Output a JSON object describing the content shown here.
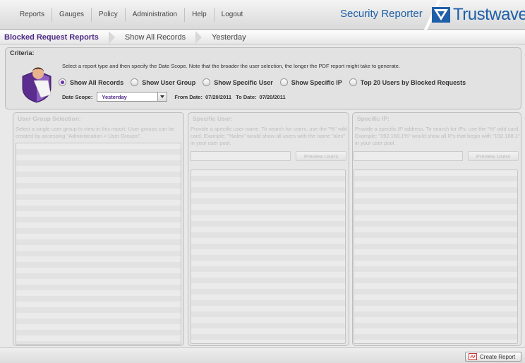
{
  "nav": {
    "items": [
      "Reports",
      "Gauges",
      "Policy",
      "Administration",
      "Help",
      "Logout"
    ]
  },
  "header": {
    "app_title": "Security Reporter",
    "brand_name": "Trustwave",
    "brand_mark": "®",
    "brand_color": "#1e5fa8"
  },
  "breadcrumb": {
    "items": [
      "Blocked Request Reports",
      "Show All Records",
      "Yesterday"
    ]
  },
  "criteria": {
    "title": "Criteria:",
    "instructions": "Select a report type and then specify the Date Scope. Note that the broader the user selection, the longer the PDF report might take to generate.",
    "report_types": [
      {
        "label": "Show All Records",
        "checked": true
      },
      {
        "label": "Show User Group",
        "checked": false
      },
      {
        "label": "Show Specific User",
        "checked": false
      },
      {
        "label": "Show Specific IP",
        "checked": false
      },
      {
        "label": "Top 20 Users by Blocked Requests",
        "checked": false
      }
    ],
    "date_scope_label": "Date Scope:",
    "date_scope_value": "Yesterday",
    "from_date_label": "From Date:",
    "from_date": "07/20/2011",
    "to_date_label": "To Date:",
    "to_date": "07/20/2011"
  },
  "panels": {
    "user_group": {
      "title": "User Group Selection:",
      "description": "Select a single user group to view in this report. User groups can be created by accessing \"Administration > User Groups\"."
    },
    "specific_user": {
      "title": "Specific User:",
      "description": "Provide a specific user name. To search for users, use the \"%\" wild card. Example: \"%alex\" would show all users with the name \"alex\" in your user pool.",
      "button_label": "Preview Users"
    },
    "specific_ip": {
      "title": "Specific IP:",
      "description": "Provide a specific IP address. To search for IPs, use the \"%\" wild card. Example: \"192.168.1%\" would show all IPs that begin with \"192.168.1\" in your user pool.",
      "button_label": "Preview Users"
    }
  },
  "footer": {
    "create_report_label": "Create Report"
  },
  "icons": {
    "shield": "user-shield-icon",
    "pdf": "pdf-icon"
  },
  "colors": {
    "accent_purple": "#4e2a86",
    "app_title_blue": "#1d5fa6"
  }
}
